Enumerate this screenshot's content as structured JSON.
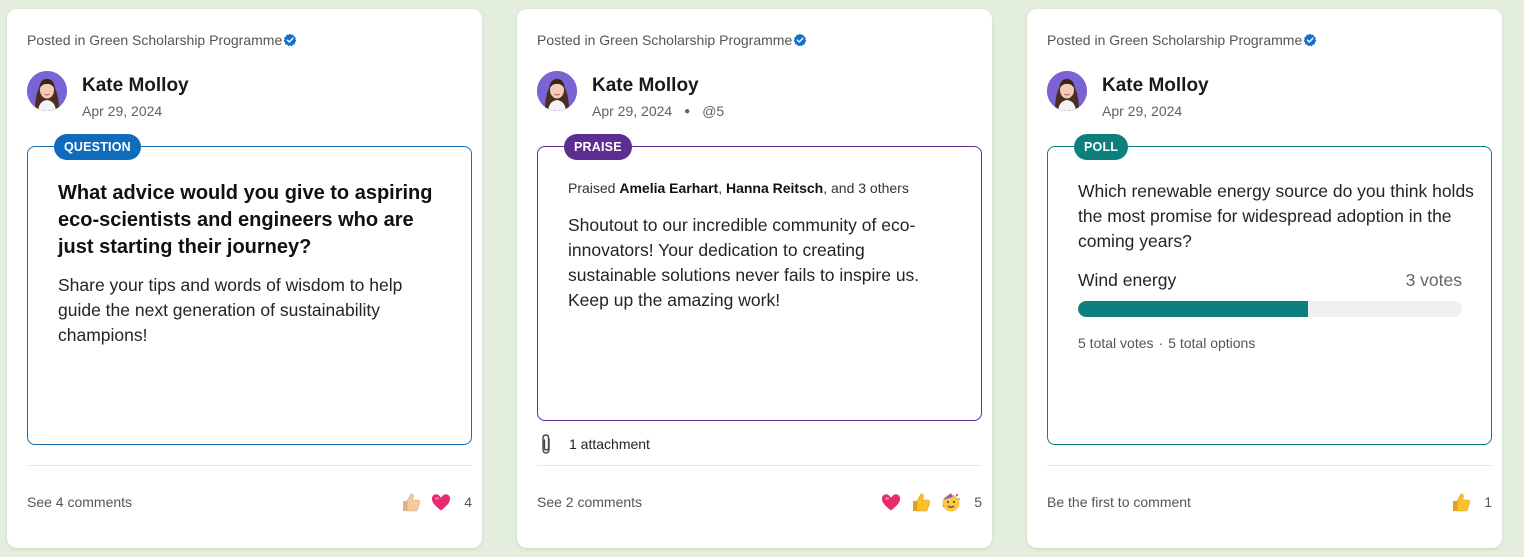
{
  "colors": {
    "question": "#0f6cbd",
    "praise": "#5c2e91",
    "poll": "#0e7f7f",
    "page_background": "#e3eedd"
  },
  "cards": [
    {
      "posted_in": "Posted in Green Scholarship Programme",
      "verified_icon": "verified-badge-icon",
      "author": "Kate Molloy",
      "date": "Apr 29, 2024",
      "tag": "QUESTION",
      "title": "What advice would you give to aspiring eco-scientists and engineers who are just starting their journey?",
      "body": "Share your tips and words of wisdom to help guide the next generation of sustainability champions!",
      "comments": "See 4 comments",
      "reactions": [
        "thumbs-up-icon",
        "heart-icon"
      ],
      "reaction_count": "4"
    },
    {
      "posted_in": "Posted in Green Scholarship Programme",
      "verified_icon": "verified-badge-icon",
      "author": "Kate Molloy",
      "date": "Apr 29, 2024",
      "seen": "@5",
      "tag": "PRAISE",
      "praised_prefix": "Praised",
      "praised_person_1": "Amelia Earhart",
      "praised_sep": ",",
      "praised_person_2": "Hanna Reitsch",
      "praised_suffix": ", and 3 others",
      "body": "Shoutout to our incredible community of eco-innovators! Your dedication to creating sustainable solutions never fails to inspire us. Keep up the amazing work!",
      "attachment": "1 attachment",
      "comments": "See 2 comments",
      "reactions": [
        "heart-icon",
        "thumbs-up-icon",
        "celebrate-icon"
      ],
      "reaction_count": "5"
    },
    {
      "posted_in": "Posted in Green Scholarship Programme",
      "verified_icon": "verified-badge-icon",
      "author": "Kate Molloy",
      "date": "Apr 29, 2024",
      "tag": "POLL",
      "question": "Which renewable energy source do you think holds the most promise for widespread adoption in the coming years?",
      "option_label": "Wind energy",
      "option_votes": "3 votes",
      "option_fraction": 0.6,
      "total_votes": "5 total votes",
      "summary_sep": "·",
      "total_options": "5 total options",
      "comments": "Be the first to comment",
      "reactions": [
        "thumbs-up-icon"
      ],
      "reaction_count": "1"
    }
  ]
}
